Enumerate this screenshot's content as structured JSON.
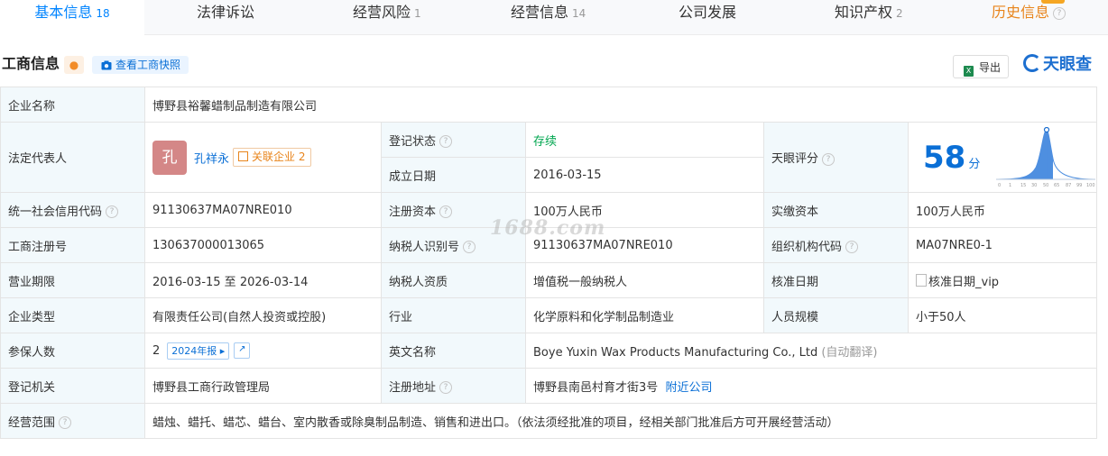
{
  "tabs": [
    {
      "label": "基本信息",
      "count": "18"
    },
    {
      "label": "法律诉讼",
      "count": ""
    },
    {
      "label": "经营风险",
      "count": "1"
    },
    {
      "label": "经营信息",
      "count": "14"
    },
    {
      "label": "公司发展",
      "count": ""
    },
    {
      "label": "知识产权",
      "count": "2"
    },
    {
      "label": "历史信息",
      "count": ""
    }
  ],
  "header": {
    "title": "工商信息",
    "snapshot_label": "查看工商快照",
    "export_label": "导出",
    "logo_text": "天眼查"
  },
  "fields": {
    "company_name_label": "企业名称",
    "company_name": "博野县裕馨蜡制品制造有限公司",
    "legal_rep_label": "法定代表人",
    "legal_rep_avatar": "孔",
    "legal_rep_name": "孔祥永",
    "related_label": "关联企业",
    "related_count": "2",
    "reg_status_label": "登记状态",
    "reg_status": "存续",
    "est_date_label": "成立日期",
    "est_date": "2016-03-15",
    "score_label": "天眼评分",
    "score": "58",
    "score_unit": "分",
    "credit_code_label": "统一社会信用代码",
    "credit_code": "91130637MA07NRE010",
    "reg_capital_label": "注册资本",
    "reg_capital": "100万人民币",
    "paid_capital_label": "实缴资本",
    "paid_capital": "100万人民币",
    "reg_no_label": "工商注册号",
    "reg_no": "130637000013065",
    "taxpayer_id_label": "纳税人识别号",
    "taxpayer_id": "91130637MA07NRE010",
    "org_code_label": "组织机构代码",
    "org_code": "MA07NRE0-1",
    "term_label": "营业期限",
    "term": "2016-03-15 至 2026-03-14",
    "taxpayer_qual_label": "纳税人资质",
    "taxpayer_qual": "增值税一般纳税人",
    "approve_date_label": "核准日期",
    "approve_date": "核准日期_vip",
    "company_type_label": "企业类型",
    "company_type": "有限责任公司(自然人投资或控股)",
    "industry_label": "行业",
    "industry": "化学原料和化学制品制造业",
    "staff_size_label": "人员规模",
    "staff_size": "小于50人",
    "insured_label": "参保人数",
    "insured": "2",
    "report_label": "2024年报",
    "english_name_label": "英文名称",
    "english_name": "Boye Yuxin Wax Products Manufacturing Co., Ltd",
    "auto_translate": "(自动翻译)",
    "authority_label": "登记机关",
    "authority": "博野县工商行政管理局",
    "address_label": "注册地址",
    "address": "博野县南邑村育才街3号",
    "nearby_label": "附近公司",
    "scope_label": "经营范围",
    "scope": "蜡烛、蜡托、蜡芯、蜡台、室内散香或除臭制品制造、销售和进出口。（依法须经批准的项目，经相关部门批准后方可开展经营活动）"
  },
  "score_chart": {
    "ticks": [
      "0",
      "1",
      "15",
      "30",
      "50",
      "65",
      "87",
      "99",
      "100"
    ]
  },
  "watermark": "1688.com",
  "colors": {
    "accent": "#0084ff",
    "status_green": "#00a64f",
    "history_orange": "#e8841b"
  }
}
